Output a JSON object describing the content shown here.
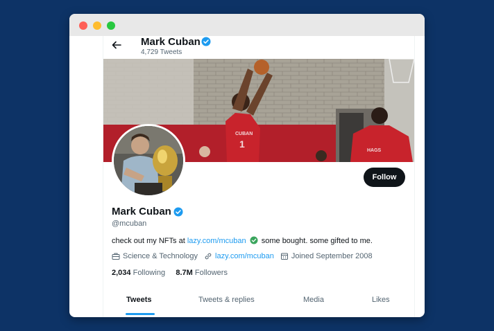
{
  "profile": {
    "header_name": "Mark Cuban",
    "tweet_count": "4,729 Tweets",
    "name": "Mark Cuban",
    "handle": "@mcuban",
    "bio_prefix": "check out my NFTs at",
    "bio_link": "lazy.com/mcuban",
    "bio_suffix": "some bought. some gifted to me.",
    "category": "Science & Technology",
    "website": "lazy.com/mcuban",
    "joined": "Joined September 2008",
    "following_count": "2,034",
    "following_label": "Following",
    "followers_count": "8.7M",
    "followers_label": "Followers",
    "follow_button": "Follow"
  },
  "banner": {
    "jersey_left": "CUBAN",
    "jersey_number": "1",
    "jersey_right": "HAGS"
  },
  "tabs": [
    "Tweets",
    "Tweets & replies",
    "Media",
    "Likes"
  ],
  "icons": {
    "back": "back-arrow-icon",
    "verified": "verified-badge-icon",
    "category": "briefcase-icon",
    "website": "link-icon",
    "joined": "calendar-icon",
    "bio_check": "green-check-icon"
  },
  "colors": {
    "background": "#0d3366",
    "accent": "#1d9bf0",
    "text": "#0f1419",
    "muted": "#536471",
    "bio_check": "#3aa55d"
  }
}
